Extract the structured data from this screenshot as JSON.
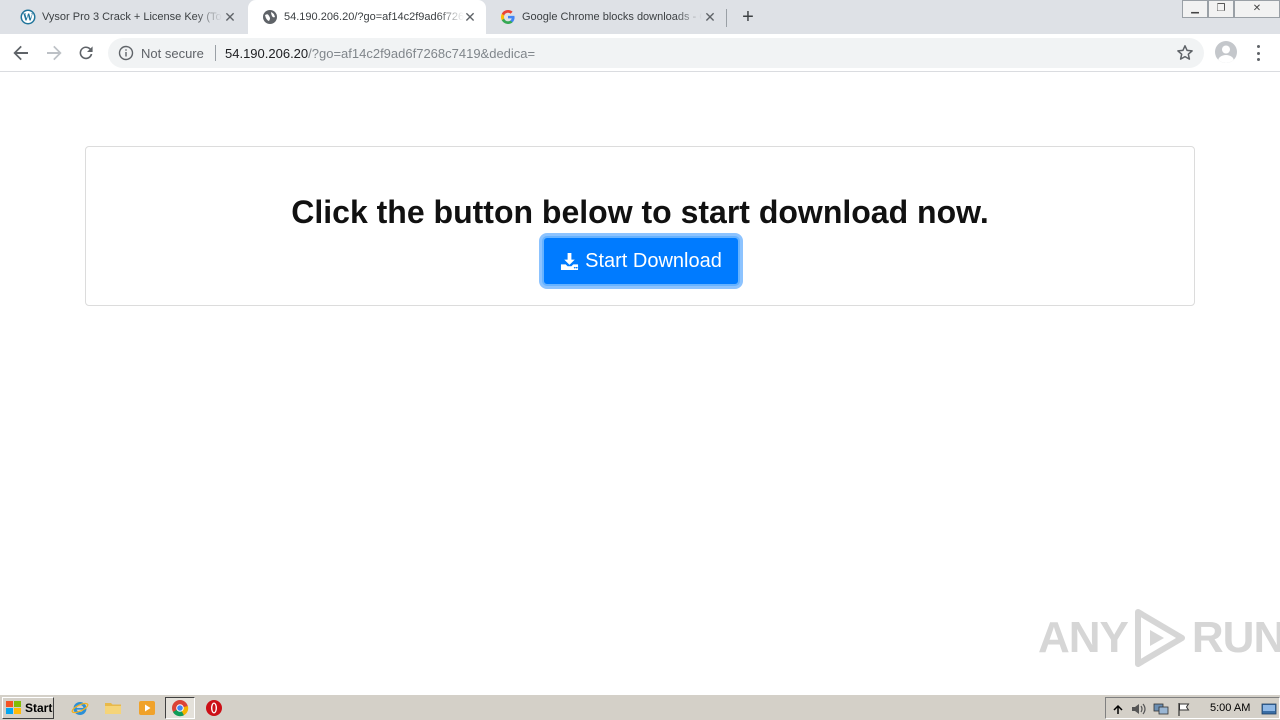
{
  "tabs": [
    {
      "title": "Vysor Pro 3 Crack + License Key (Tor",
      "favicon": "wordpress-icon",
      "active": false
    },
    {
      "title": "54.190.206.20/?go=af14c2f9ad6f7268c",
      "favicon": "globe-icon",
      "active": true
    },
    {
      "title": "Google Chrome blocks downloads - G",
      "favicon": "google-icon",
      "active": false
    }
  ],
  "omnibox": {
    "security_label": "Not secure",
    "url_host": "54.190.206.20",
    "url_path": "/?go=af14c2f9ad6f7268c7419&dedica="
  },
  "page": {
    "heading": "Click the button below to start download now.",
    "download_button_label": "Start Download"
  },
  "watermark": {
    "left": "ANY",
    "right": "RUN"
  },
  "taskbar": {
    "start_label": "Start",
    "clock": "5:00 AM"
  },
  "colors": {
    "accent": "#007bff",
    "tab_strip": "#dee1e6",
    "omnibox": "#f1f3f4"
  }
}
